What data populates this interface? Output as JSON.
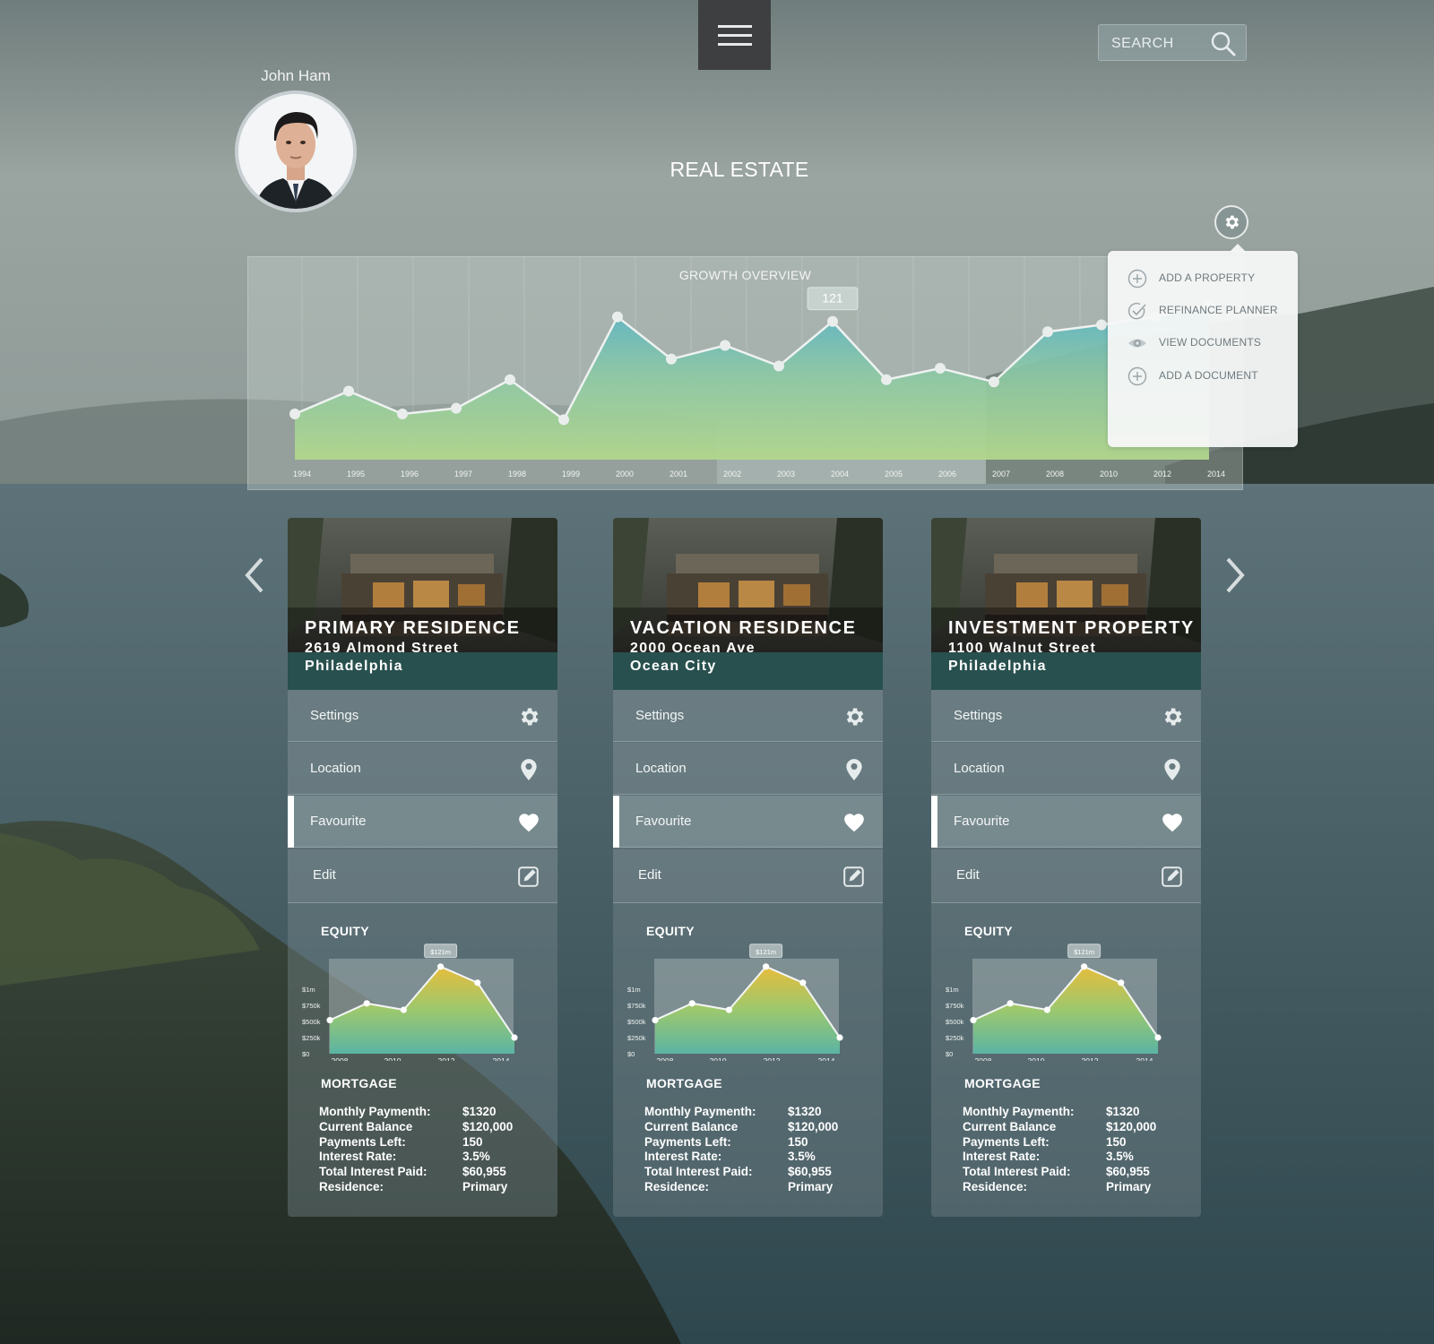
{
  "header": {
    "menu_icon": "hamburger-icon",
    "search_placeholder": "SEARCH",
    "search_icon": "search-icon"
  },
  "user": {
    "name": "John Ham"
  },
  "page_title": "REAL ESTATE",
  "growth_chart": {
    "title": "GROWTH OVERVIEW",
    "tooltip_value": "121",
    "accent_colors": [
      "#a9d48a",
      "#6cc2c0",
      "#4aa3d4"
    ]
  },
  "settings_menu": {
    "items": [
      {
        "label": "ADD A PROPERTY",
        "icon": "plus-circle-icon"
      },
      {
        "label": "REFINANCE PLANNER",
        "icon": "check-icon"
      },
      {
        "label": "VIEW DOCUMENTS",
        "icon": "eye-icon"
      },
      {
        "label": "ADD A DOCUMENT",
        "icon": "plus-circle-icon"
      }
    ]
  },
  "properties": [
    {
      "title": "PRIMARY RESIDENCE",
      "line1": "2619 Almond Street",
      "line2": "Philadelphia"
    },
    {
      "title": "VACATION RESIDENCE",
      "line1": "2000 Ocean Ave",
      "line2": "Ocean City"
    },
    {
      "title": "INVESTMENT PROPERTY",
      "line1": "1100 Walnut Street",
      "line2": "Philadelphia"
    }
  ],
  "card_menu": {
    "settings": "Settings",
    "location": "Location",
    "favourite": "Favourite",
    "edit": "Edit"
  },
  "equity": {
    "title": "EQUITY",
    "tooltip": "$121m",
    "accent_colors": [
      "#e8c84a",
      "#9ccf7c",
      "#5fb7a8"
    ]
  },
  "mortgage": {
    "title": "MORTGAGE",
    "rows": [
      {
        "label": "Monthly Paymenth:",
        "value": "$1320"
      },
      {
        "label": "Current Balance",
        "value": "$120,000"
      },
      {
        "label": "Payments Left:",
        "value": "150"
      },
      {
        "label": "Interest Rate:",
        "value": "3.5%"
      },
      {
        "label": "Total Interest Paid:",
        "value": "$60,955"
      },
      {
        "label": "Residence:",
        "value": "Primary"
      }
    ]
  },
  "chart_data": [
    {
      "type": "area",
      "title": "GROWTH OVERVIEW",
      "x": [
        "1994",
        "1995",
        "1996",
        "1997",
        "1998",
        "1999",
        "2000",
        "2001",
        "2002",
        "2003",
        "2004",
        "2005",
        "2006",
        "2007",
        "2008",
        "2010",
        "2012",
        "2014"
      ],
      "series": [
        {
          "values": [
            40,
            60,
            40,
            45,
            70,
            35,
            125,
            88,
            100,
            82,
            121,
            70,
            80,
            68,
            112,
            118,
            125,
            135
          ]
        }
      ],
      "annotations": [
        "121"
      ],
      "grid": true
    },
    {
      "type": "area",
      "title": "EQUITY",
      "x": [
        "2008",
        "2010",
        "2012",
        "2014"
      ],
      "yticks": [
        "$0",
        "$250k",
        "$500k",
        "$750k",
        "$1m"
      ],
      "series": [
        {
          "values": [
            0.52,
            0.78,
            0.68,
            1.35,
            1.1,
            0.25
          ]
        }
      ],
      "annotations": [
        "$121m"
      ]
    }
  ]
}
